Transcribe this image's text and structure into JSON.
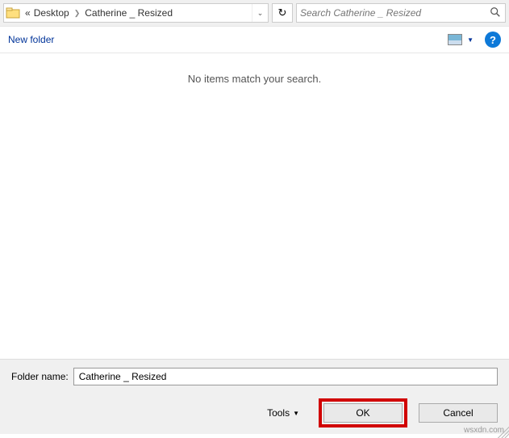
{
  "breadcrumb": {
    "prefix": "«",
    "part1": "Desktop",
    "part2": "Catherine _ Resized"
  },
  "search": {
    "placeholder": "Search Catherine _ Resized"
  },
  "toolbar": {
    "new_folder": "New folder"
  },
  "main": {
    "empty_msg": "No items match your search."
  },
  "bottom": {
    "folder_label": "Folder name:",
    "folder_value": "Catherine _ Resized",
    "tools_label": "Tools",
    "ok_label": "OK",
    "cancel_label": "Cancel"
  },
  "watermark": "wsxdn.com"
}
